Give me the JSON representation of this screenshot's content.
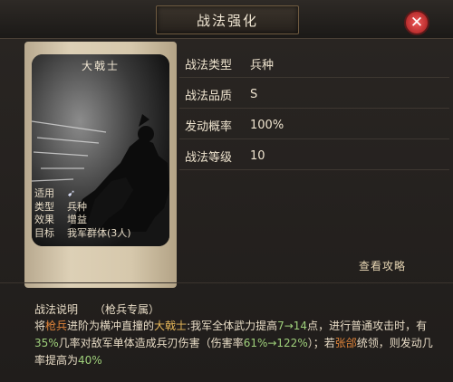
{
  "header": {
    "title": "战法强化"
  },
  "card": {
    "name": "大戟士",
    "stats": [
      {
        "key": "适用",
        "value": "",
        "icon": "cavalry-icon"
      },
      {
        "key": "类型",
        "value": "兵种"
      },
      {
        "key": "效果",
        "value": "增益"
      },
      {
        "key": "目标",
        "value": "我军群体(3人)"
      }
    ]
  },
  "attributes": [
    {
      "label": "战法类型",
      "value": "兵种"
    },
    {
      "label": "战法品质",
      "value": "S"
    },
    {
      "label": "发动概率",
      "value": "100%"
    },
    {
      "label": "战法等级",
      "value": "10"
    }
  ],
  "guide_link": "查看攻略",
  "description": {
    "title": "战法说明",
    "tag": "（枪兵专属）",
    "parts": [
      {
        "text": "将",
        "style": ""
      },
      {
        "text": "枪兵",
        "style": "orange"
      },
      {
        "text": "进阶为横冲直撞的",
        "style": ""
      },
      {
        "text": "大戟士",
        "style": "gold"
      },
      {
        "text": ":我军全体武力提高",
        "style": ""
      },
      {
        "text": "7→14",
        "style": "green"
      },
      {
        "text": "点，进行普通攻击时，有",
        "style": ""
      },
      {
        "text": "35%",
        "style": "green"
      },
      {
        "text": "几率对敌军单体造成兵刃伤害（伤害率",
        "style": ""
      },
      {
        "text": "61%→122%",
        "style": "green"
      },
      {
        "text": "）；若",
        "style": ""
      },
      {
        "text": "张郃",
        "style": "orange"
      },
      {
        "text": "统领，则发动几率提高为",
        "style": ""
      },
      {
        "text": "40%",
        "style": "green"
      }
    ]
  },
  "colors": {
    "accent_orange": "#e0843a",
    "accent_gold": "#e9b95a",
    "accent_green": "#9fd07b"
  }
}
